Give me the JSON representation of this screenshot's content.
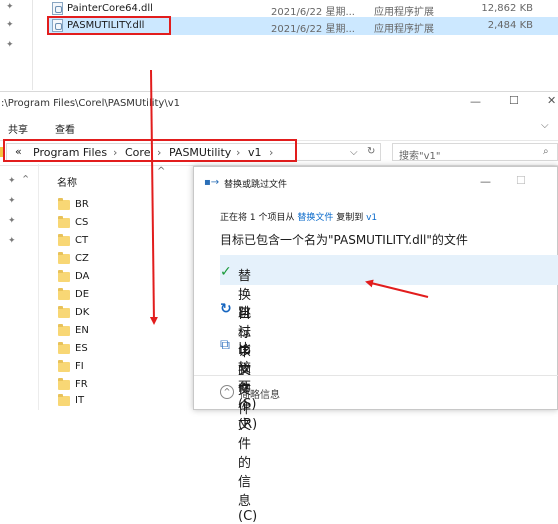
{
  "top_files": [
    {
      "name": "PainterCore64.dll",
      "date": "2021/6/22 星期...",
      "type": "应用程序扩展",
      "size": "12,862 KB"
    },
    {
      "name": "PASMUTILITY.dll",
      "date": "2021/6/22 星期...",
      "type": "应用程序扩展",
      "size": "2,484 KB"
    }
  ],
  "window": {
    "title": ":\\Program Files\\Corel\\PASMUtility\\v1"
  },
  "ribbon": {
    "share": "共享",
    "view": "查看"
  },
  "breadcrumb": {
    "prefix": "«",
    "items": [
      "Program Files",
      "Corel",
      "PASMUtility",
      "v1"
    ],
    "sep": "›"
  },
  "search": {
    "placeholder": "搜索\"v1\""
  },
  "list": {
    "header": "名称",
    "folders": [
      "BR",
      "CS",
      "CT",
      "CZ",
      "DA",
      "DE",
      "DK",
      "EN",
      "ES",
      "FI",
      "FR",
      "IT"
    ]
  },
  "dialog": {
    "title": "替换或跳过文件",
    "line1_pre": "正在将 1 个项目从 ",
    "line1_src": "替换文件",
    "line1_mid": " 复制到 ",
    "line1_dst": "v1",
    "heading": "目标已包含一个名为\"PASMUTILITY.dll\"的文件",
    "opt_replace": "替换目标中的文件(R)",
    "opt_skip": "跳过该文件(S)",
    "opt_compare": "比较两个文件的信息(C)",
    "details": "简略信息"
  },
  "colors": {
    "highlight_red": "#e21d1d",
    "link_blue": "#0b6bcb",
    "check_green": "#1a9a3a",
    "selected_row": "#cce8ff"
  }
}
